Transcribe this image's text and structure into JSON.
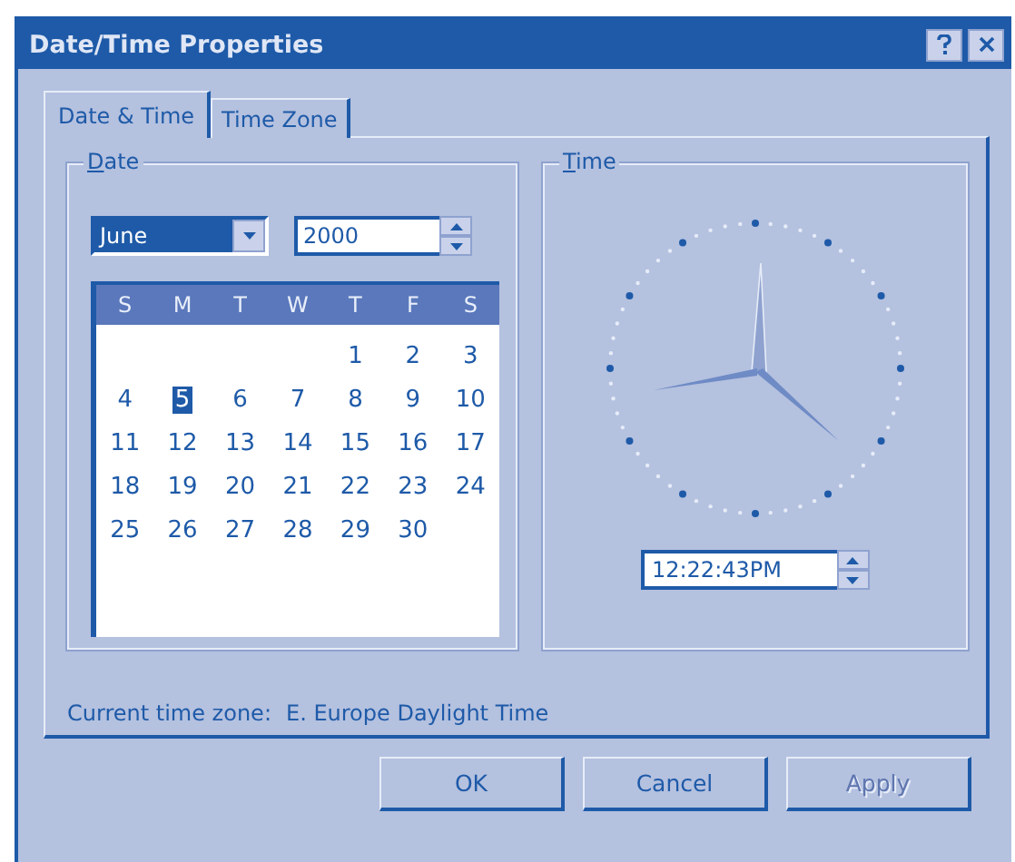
{
  "window": {
    "title": "Date/Time Properties"
  },
  "tabs": [
    {
      "label": "Date & Time",
      "selected": true
    },
    {
      "label": "Time Zone",
      "selected": false
    }
  ],
  "date_group": {
    "label": "Date",
    "month": "June",
    "year": "2000",
    "calendar": {
      "weekdays": [
        "S",
        "M",
        "T",
        "W",
        "T",
        "F",
        "S"
      ],
      "weeks": [
        [
          {
            "day": "1",
            "selected": false
          },
          {
            "day": "2",
            "selected": false
          },
          {
            "day": "3",
            "selected": false
          }
        ],
        [
          {
            "day": "4",
            "selected": false
          },
          {
            "day": "5",
            "selected": true
          },
          {
            "day": "6",
            "selected": false
          },
          {
            "day": "7",
            "selected": false
          },
          {
            "day": "8",
            "selected": false
          },
          {
            "day": "9",
            "selected": false
          },
          {
            "day": "10",
            "selected": false
          }
        ],
        [
          {
            "day": "11",
            "selected": false
          },
          {
            "day": "12",
            "selected": false
          },
          {
            "day": "13",
            "selected": false
          },
          {
            "day": "14",
            "selected": false
          },
          {
            "day": "15",
            "selected": false
          },
          {
            "day": "16",
            "selected": false
          },
          {
            "day": "17",
            "selected": false
          }
        ],
        [
          {
            "day": "18",
            "selected": false
          },
          {
            "day": "19",
            "selected": false
          },
          {
            "day": "20",
            "selected": false
          },
          {
            "day": "21",
            "selected": false
          },
          {
            "day": "22",
            "selected": false
          },
          {
            "day": "23",
            "selected": false
          },
          {
            "day": "24",
            "selected": false
          }
        ],
        [
          {
            "day": "25",
            "selected": false
          },
          {
            "day": "26",
            "selected": false
          },
          {
            "day": "27",
            "selected": false
          },
          {
            "day": "28",
            "selected": false
          },
          {
            "day": "29",
            "selected": false
          },
          {
            "day": "30",
            "selected": false
          }
        ]
      ]
    }
  },
  "time_group": {
    "label": "Time",
    "time": "12:22:43PM"
  },
  "time_zone": {
    "label": "Current time zone:",
    "value": "E. Europe Daylight Time"
  },
  "buttons": [
    {
      "label": "OK",
      "disabled": false
    },
    {
      "label": "Cancel",
      "disabled": false
    },
    {
      "label": "Apply",
      "disabled": true
    }
  ]
}
